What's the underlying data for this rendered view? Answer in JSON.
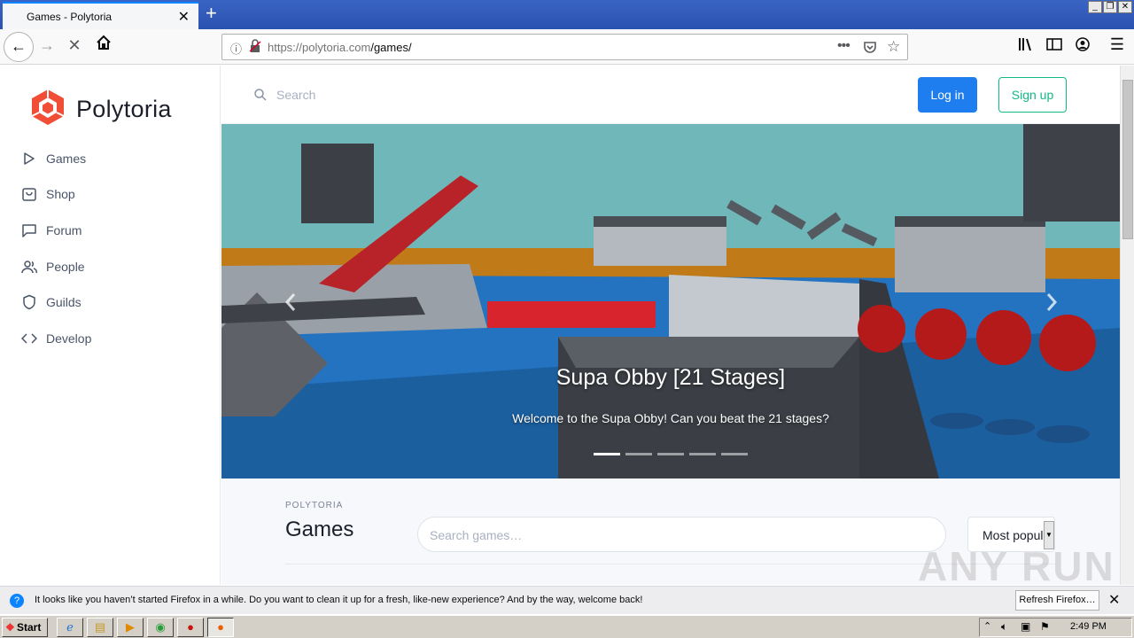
{
  "browser": {
    "tab_title": "Games - Polytoria",
    "url_host": "https://polytoria.com",
    "url_path": "/games/",
    "notification": "It looks like you haven’t started Firefox in a while. Do you want to clean it up for a fresh, like-new experience? And by the way, welcome back!",
    "refresh_button": "Refresh Firefox…",
    "icons": [
      "back-icon",
      "forward-icon",
      "stop-icon",
      "home-icon",
      "info-icon",
      "lock-icon",
      "more-icon",
      "pocket-icon",
      "star-icon",
      "library-icon",
      "sidebar-icon",
      "account-icon",
      "menu-icon"
    ]
  },
  "brand": {
    "name": "Polytoria",
    "accent": "#f04e37"
  },
  "sidebar": {
    "items": [
      {
        "label": "Games",
        "icon": "play-icon"
      },
      {
        "label": "Shop",
        "icon": "bag-icon"
      },
      {
        "label": "Forum",
        "icon": "chat-icon"
      },
      {
        "label": "People",
        "icon": "people-icon"
      },
      {
        "label": "Guilds",
        "icon": "shield-icon"
      },
      {
        "label": "Develop",
        "icon": "code-icon"
      }
    ]
  },
  "header": {
    "search_placeholder": "Search",
    "login": "Log in",
    "signup": "Sign up",
    "login_color": "#1e7ef0",
    "signup_color": "#12b886"
  },
  "hero": {
    "title": "Supa Obby [21 Stages]",
    "subtitle": "Welcome to the Supa Obby! Can you beat the 21 stages?",
    "slide_count": 5,
    "active_slide": 1
  },
  "games": {
    "eyebrow": "POLYTORIA",
    "heading": "Games",
    "search_placeholder": "Search games…",
    "sort_selected": "Most popular"
  },
  "taskbar": {
    "start": "Start",
    "clock": "2:49 PM"
  },
  "watermark": "ANY RUN"
}
